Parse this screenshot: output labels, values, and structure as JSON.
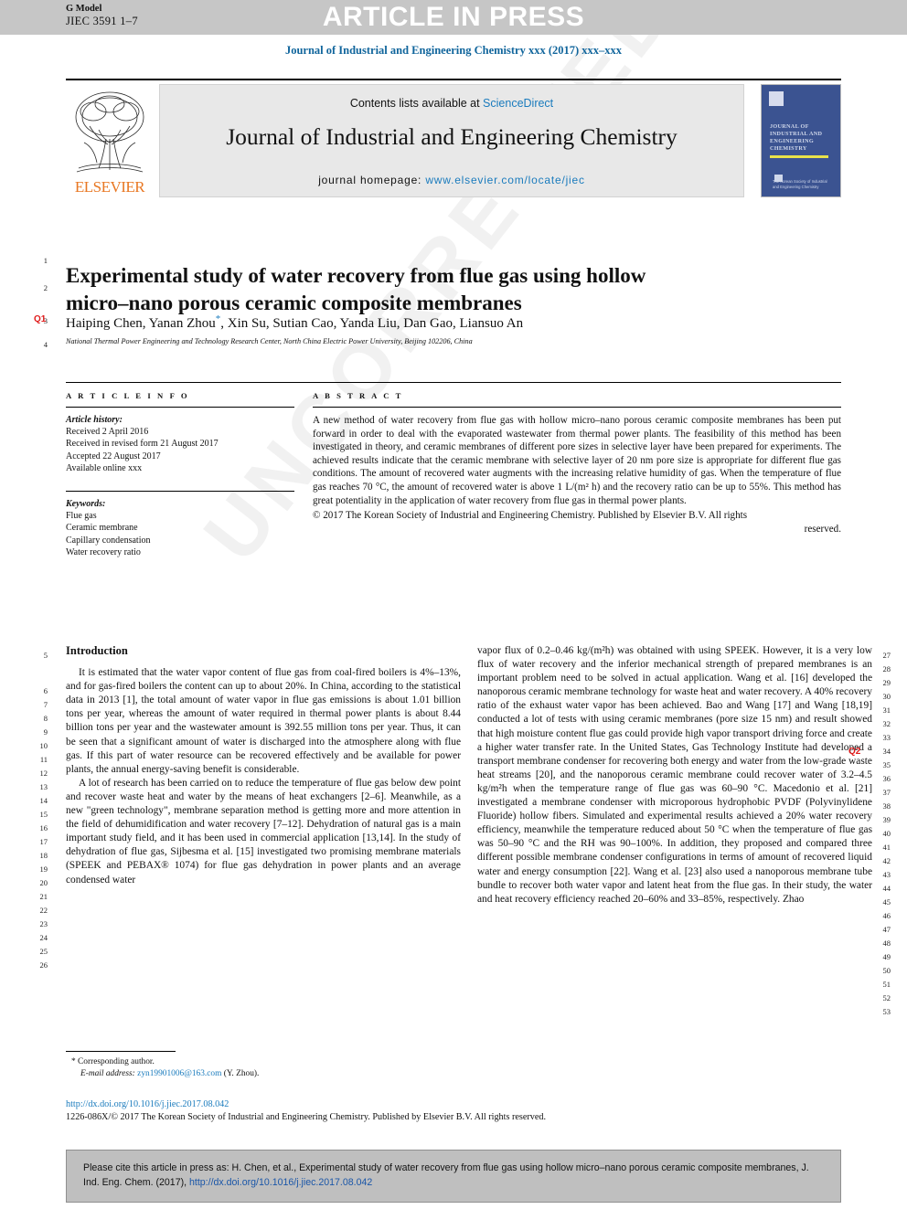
{
  "header": {
    "g_model_label": "G Model",
    "g_model_id": "JIEC 3591 1–7",
    "article_in_press": "ARTICLE IN PRESS",
    "journal_citation": "Journal of Industrial and Engineering Chemistry xxx (2017) xxx–xxx"
  },
  "masthead": {
    "contents_prefix": "Contents lists available at ",
    "sciencedirect": "ScienceDirect",
    "journal_title": "Journal of Industrial and Engineering Chemistry",
    "homepage_prefix": "journal homepage: ",
    "homepage_url": "www.elsevier.com/locate/jiec",
    "publisher": "ELSEVIER",
    "cover_title": "Journal of Industrial and Engineering Chemistry",
    "cover_footer": "The Korean Society of Industrial and Engineering Chemistry"
  },
  "article": {
    "title": "Experimental study of water recovery from flue gas using hollow micro–nano porous ceramic composite membranes",
    "authors": "Haiping Chen, Yanan Zhou",
    "authors_rest": ", Xin Su, Sutian Cao, Yanda Liu, Dan Gao, Liansuo An",
    "corresponding_mark": "*",
    "affiliation": "National Thermal Power Engineering and Technology Research Center, North China Electric Power University, Beijing 102206, China"
  },
  "article_info": {
    "heading": "A R T I C L E   I N F O",
    "history_label": "Article history:",
    "history": [
      "Received 2 April 2016",
      "Received in revised form 21 August 2017",
      "Accepted 22 August 2017",
      "Available online xxx"
    ],
    "keywords_label": "Keywords:",
    "keywords": [
      "Flue gas",
      "Ceramic membrane",
      "Capillary condensation",
      "Water recovery ratio"
    ]
  },
  "abstract": {
    "heading": "A B S T R A C T",
    "body": "A new method of water recovery from flue gas with hollow micro–nano porous ceramic composite membranes has been put forward in order to deal with the evaporated wastewater from thermal power plants. The feasibility of this method has been investigated in theory, and ceramic membranes of different pore sizes in selective layer have been prepared for experiments. The achieved results indicate that the ceramic membrane with selective layer of 20 nm pore size is appropriate for different flue gas conditions. The amount of recovered water augments with the increasing relative humidity of gas. When the temperature of flue gas reaches 70 °C, the amount of recovered water is above 1 L/(m² h) and the recovery ratio can be up to 55%. This method has great potentiality in the application of water recovery from flue gas in thermal power plants.",
    "copyright": "© 2017 The Korean Society of Industrial and Engineering Chemistry. Published by Elsevier B.V. All rights",
    "copyright_tail": "reserved."
  },
  "introduction": {
    "heading": "Introduction",
    "paragraph_1": "It is estimated that the water vapor content of flue gas from coal-fired boilers is 4%–13%, and for gas-fired boilers the content can up to about 20%. In China, according to the statistical data in 2013 [1], the total amount of water vapor in flue gas emissions is about 1.01 billion tons per year, whereas the amount of water required in thermal power plants is about 8.44 billion tons per year and the wastewater amount is 392.55 million tons per year. Thus, it can be seen that a significant amount of water is discharged into the atmosphere along with flue gas. If this part of water resource can be recovered effectively and be available for power plants, the annual energy-saving benefit is considerable.",
    "paragraph_2": "A lot of research has been carried on to reduce the temperature of flue gas below dew point and recover waste heat and water by the means of heat exchangers [2–6]. Meanwhile, as a new \"green technology\", membrane separation method is getting more and more attention in the field of dehumidification and water recovery [7–12]. Dehydration of natural gas is a main important study field, and it has been used in commercial application [13,14]. In the study of dehydration of flue gas, Sijbesma et al. [15] investigated two promising membrane materials (SPEEK and PEBAX® 1074) for flue gas dehydration in power plants and an average condensed water",
    "paragraph_3": "vapor flux of 0.2–0.46 kg/(m²h) was obtained with using SPEEK. However, it is a very low flux of water recovery and the inferior mechanical strength of prepared membranes is an important problem need to be solved in actual application. Wang et al. [16] developed the nanoporous ceramic membrane technology for waste heat and water recovery. A 40% recovery ratio of the exhaust water vapor has been achieved. Bao and Wang [17] and Wang [18,19] conducted a lot of tests with using ceramic membranes (pore size 15 nm) and result showed that high moisture content flue gas could provide high vapor transport driving force and create a higher water transfer rate. In the United States, Gas Technology Institute had developed a transport membrane condenser for recovering both energy and water from the low-grade waste heat streams [20], and the nanoporous ceramic membrane could recover water of 3.2–4.5 kg/m²h when the temperature range of flue gas was 60–90 °C. Macedonio et al. [21] investigated a membrane condenser with microporous hydrophobic PVDF (Polyvinylidene Fluoride) hollow fibers. Simulated and experimental results achieved a 20% water recovery efficiency, meanwhile the temperature reduced about 50 °C when the temperature of flue gas was 50–90 °C and the RH was 90–100%. In addition, they proposed and compared three different possible membrane condenser configurations in terms of amount of recovered liquid water and energy consumption [22]. Wang et al. [23] also used a nanoporous membrane tube bundle to recover both water vapor and latent heat from the flue gas. In their study, the water and heat recovery efficiency reached 20–60% and 33–85%, respectively. Zhao"
  },
  "footnote": {
    "corresponding": "Corresponding author.",
    "email_label": "E-mail address:",
    "email": "zyn19901006@163.com",
    "email_suffix": "(Y. Zhou).",
    "doi": "http://dx.doi.org/10.1016/j.jiec.2017.08.042",
    "copyright": "1226-086X/© 2017 The Korean Society of Industrial and Engineering Chemistry. Published by Elsevier B.V. All rights reserved."
  },
  "cite_box": {
    "text_1": "Please cite this article in press as: H. Chen, et al., Experimental study of water recovery from flue gas using hollow micro–nano porous ceramic composite membranes, J. Ind. Eng. Chem. (2017), ",
    "doi_link": "http://dx.doi.org/10.1016/j.jiec.2017.08.042"
  },
  "query_markers": {
    "q1": "Q1",
    "q2": "Q2"
  },
  "line_numbers": {
    "left": [
      "1",
      "2",
      "3",
      "4",
      "5",
      "6",
      "7",
      "8",
      "9",
      "10",
      "11",
      "12",
      "13",
      "14",
      "15",
      "16",
      "17",
      "18",
      "19",
      "20",
      "21",
      "22",
      "23",
      "24",
      "25",
      "26"
    ],
    "right": [
      "27",
      "28",
      "29",
      "30",
      "31",
      "32",
      "33",
      "34",
      "35",
      "36",
      "37",
      "38",
      "39",
      "40",
      "41",
      "42",
      "43",
      "44",
      "45",
      "46",
      "47",
      "48",
      "49",
      "50",
      "51",
      "52",
      "53"
    ]
  },
  "colors": {
    "link_blue": "#1a7bbd",
    "journal_blue": "#10659c",
    "query_red": "#e01b1b",
    "elsevier_orange": "#e87722",
    "cover_blue": "#3b5391",
    "topbar_grey": "#c6c6c6",
    "citebox_grey": "#bfbfbf"
  },
  "watermark": {
    "text": "UNCORRECTED PROOF"
  }
}
